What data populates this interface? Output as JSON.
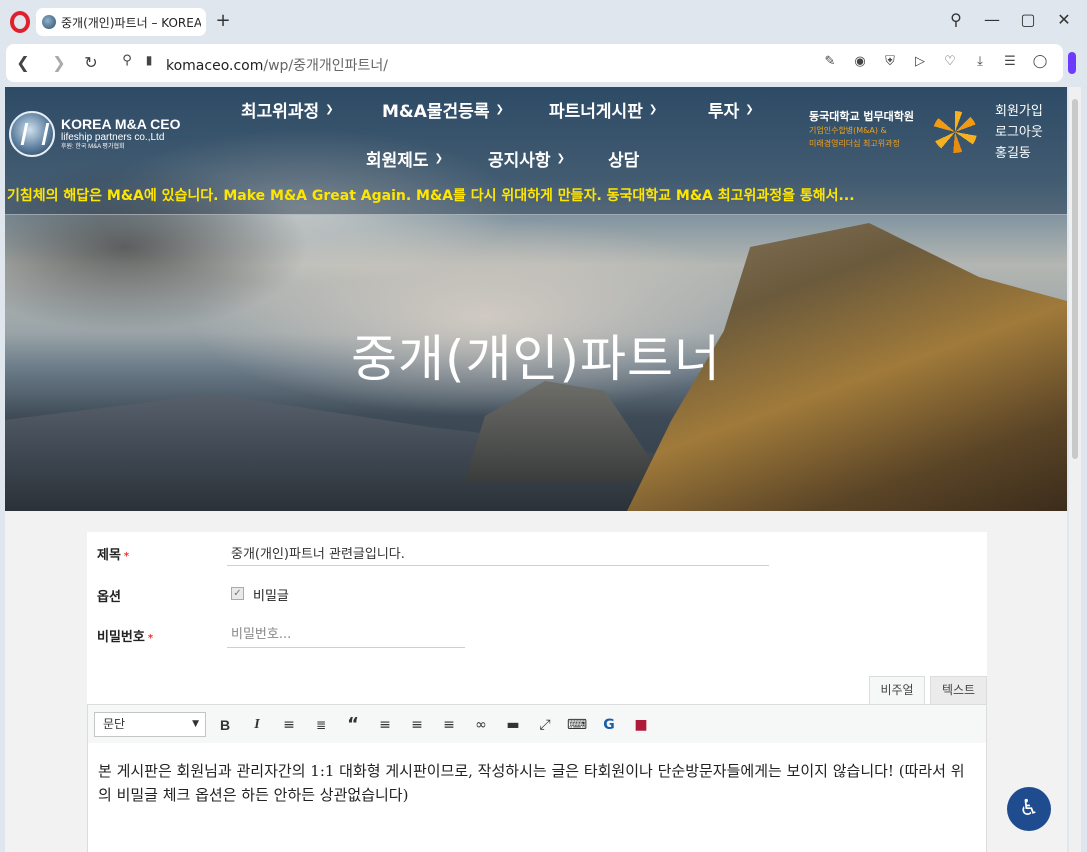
{
  "browser": {
    "tab_title": "중개(개인)파트너 – KOREA",
    "new_tab": "+",
    "url_domain": "komaceo.com",
    "url_path": "/wp/중개개인파트너/",
    "icons": [
      "back-icon",
      "forward-icon",
      "reload-icon",
      "site-info-icon",
      "lock-icon",
      "edit-icon",
      "camera-icon",
      "shield-icon",
      "play-icon",
      "heart-icon",
      "download-icon",
      "settings-icon",
      "profile-icon",
      "search-icon",
      "minimize-icon",
      "maximize-icon",
      "close-icon"
    ]
  },
  "site": {
    "logo_name": "KOREA M&A CEO",
    "logo_sub1": "lifeship partners co.,Ltd",
    "logo_sub2": "후원: 한국 M&A 평가협회",
    "menu": [
      {
        "label": "최고위과정"
      },
      {
        "label": "M&A물건등록"
      },
      {
        "label": "파트너게시판"
      },
      {
        "label": "투자"
      },
      {
        "label": "회원제도"
      },
      {
        "label": "공지사항"
      },
      {
        "label": "상담"
      }
    ],
    "dgu_line1": "동국대학교 법무대학원",
    "dgu_line2": "기업인수합병(M&A) &",
    "dgu_line3": "미래경영리더십 최고위과정",
    "member_join": "회원가입",
    "logout": "로그아웃",
    "username": "홍길동",
    "ticker": "기침체의 해답은 M&A에 있습니다. Make M&A Great Again. M&A를 다시 위대하게 만들자. 동국대학교 M&A 최고위과정을 통해서...",
    "hero_title": "중개(개인)파트너"
  },
  "form": {
    "title_label": "제목",
    "title_value": "중개(개인)파트너 관련글입니다.",
    "option_label": "옵션",
    "secret_check": "✓",
    "secret_label": "비밀글",
    "password_label": "비밀번호",
    "password_placeholder": "비밀번호...",
    "required_mark": "*"
  },
  "editor": {
    "tab_visual": "비주얼",
    "tab_text": "텍스트",
    "format_select": "문단",
    "toolbar": [
      "bold",
      "italic",
      "bullet-list",
      "numbered-list",
      "blockquote",
      "align-left",
      "align-center",
      "align-right",
      "link",
      "read-more",
      "fullscreen",
      "keyboard",
      "grammarly",
      "extra"
    ],
    "content": "본 게시판은 회원님과 관리자간의 1:1 대화형 게시판이므로, 작성하시는 글은 타회원이나 단순방문자들에게는 보이지 않습니다! (따라서 위의 비밀글 체크 옵션은 하든 안하든 상관없습니다)"
  },
  "colors": {
    "ticker": "#ffe600",
    "accent_orange": "#f3a21c",
    "required": "#e33333",
    "access_button": "#1f4c8e"
  }
}
